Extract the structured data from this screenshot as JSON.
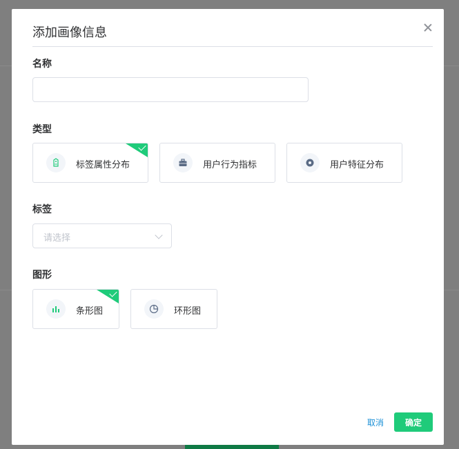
{
  "dialog": {
    "title": "添加画像信息"
  },
  "form": {
    "name_label": "名称",
    "name_value": "",
    "type_label": "类型",
    "types": [
      {
        "label": "标签属性分布",
        "icon": "tag-icon",
        "selected": true
      },
      {
        "label": "用户行为指标",
        "icon": "briefcase-icon",
        "selected": false
      },
      {
        "label": "用户特征分布",
        "icon": "target-icon",
        "selected": false
      }
    ],
    "tag_label": "标签",
    "tag_placeholder": "请选择",
    "graph_label": "图形",
    "graphs": [
      {
        "label": "条形图",
        "icon": "bar-chart-icon",
        "selected": true
      },
      {
        "label": "环形图",
        "icon": "donut-chart-icon",
        "selected": false
      }
    ]
  },
  "footer": {
    "cancel_label": "取消",
    "ok_label": "确定"
  },
  "colors": {
    "accent": "#1fcb7a",
    "link": "#1a8fd6"
  }
}
